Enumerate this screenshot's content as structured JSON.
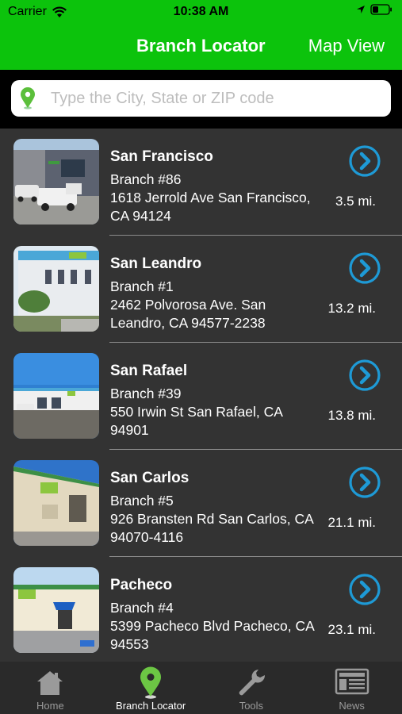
{
  "status": {
    "carrier": "Carrier",
    "time": "10:38 AM"
  },
  "header": {
    "title": "Branch Locator",
    "map_view": "Map View"
  },
  "search": {
    "placeholder": "Type the City, State or ZIP code",
    "value": ""
  },
  "branches": [
    {
      "name": "San Francisco",
      "branch": "Branch #86",
      "address": "1618 Jerrold Ave San Francisco, CA 94124",
      "distance": "3.5 mi."
    },
    {
      "name": "San Leandro",
      "branch": "Branch #1",
      "address": "2462 Polvorosa Ave. San Leandro, CA 94577-2238",
      "distance": "13.2 mi."
    },
    {
      "name": "San Rafael",
      "branch": "Branch #39",
      "address": "550 Irwin St San Rafael, CA 94901",
      "distance": "13.8 mi."
    },
    {
      "name": "San Carlos",
      "branch": "Branch #5",
      "address": "926 Bransten Rd San Carlos, CA 94070-4116",
      "distance": "21.1 mi."
    },
    {
      "name": "Pacheco",
      "branch": "Branch #4",
      "address": "5399 Pacheco Blvd Pacheco, CA 94553",
      "distance": "23.1 mi."
    }
  ],
  "tabs": [
    {
      "label": "Home",
      "icon": "home-icon"
    },
    {
      "label": "Branch Locator",
      "icon": "location-pin-icon"
    },
    {
      "label": "Tools",
      "icon": "wrench-icon"
    },
    {
      "label": "News",
      "icon": "newspaper-icon"
    }
  ],
  "colors": {
    "brand": "#0cc30c",
    "accent": "#1e9ad6",
    "list_bg": "#333333",
    "tab_bg": "#2a2a2a"
  }
}
